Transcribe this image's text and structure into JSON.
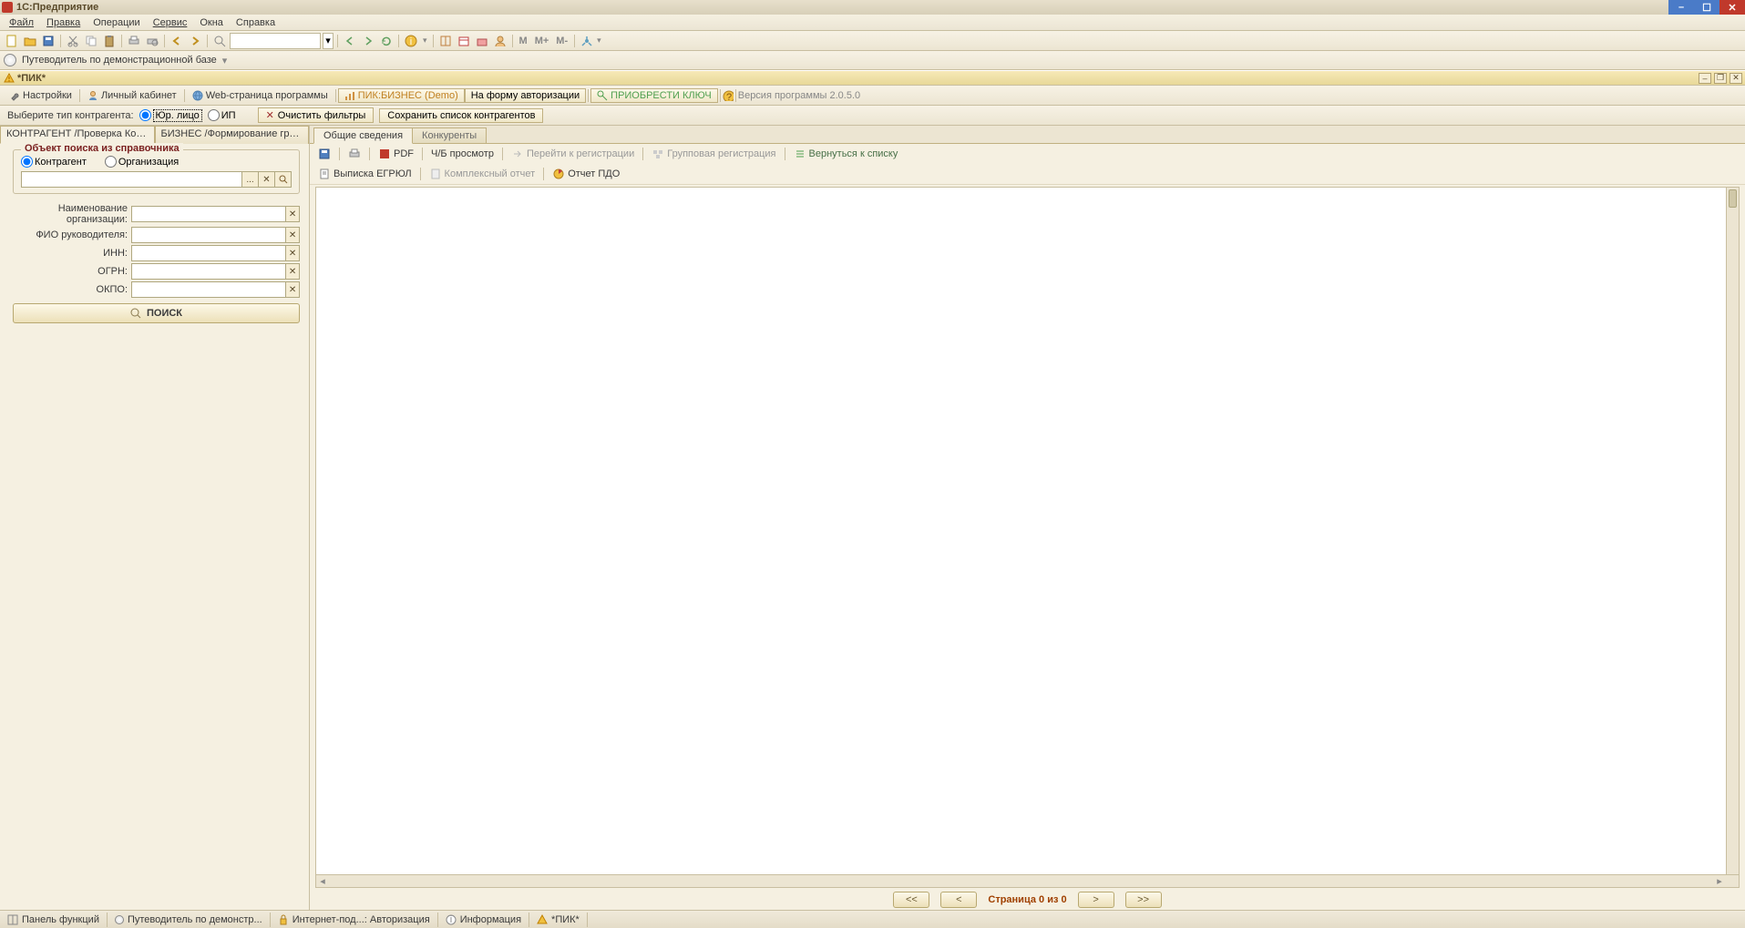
{
  "app": {
    "title": "1С:Предприятие"
  },
  "menu": [
    "Файл",
    "Правка",
    "Операции",
    "Сервис",
    "Окна",
    "Справка"
  ],
  "toolbar2": {
    "guide": "Путеводитель по демонстрационной базе"
  },
  "windowTitle": "*ПИК*",
  "tabsRow": {
    "settings": "Настройки",
    "personal": "Личный кабинет",
    "webpage": "Web-страница программы",
    "pikBusiness": "ПИК:БИЗНЕС (Demo)",
    "authForm": "На форму авторизации",
    "buyKey": "ПРИОБРЕСТИ КЛЮЧ",
    "version": "Версия программы 2.0.5.0"
  },
  "filter": {
    "label": "Выберите тип контрагента:",
    "legal": "Юр. лицо",
    "ip": "ИП",
    "clear": "Очистить фильтры",
    "save": "Сохранить список контрагентов"
  },
  "panelTabs": {
    "contr": "КОНТРАГЕНТ /Проверка Контраг ...",
    "business": "БИЗНЕС /Формирование группы ..."
  },
  "fieldset": {
    "legend": "Объект поиска из справочника",
    "contragent": "Контрагент",
    "org": "Организация"
  },
  "form": {
    "orgName": "Наименование организации:",
    "fio": "ФИО руководителя:",
    "inn": "ИНН:",
    "ogrn": "ОГРН:",
    "okpo": "ОКПО:",
    "search": "ПОИСК"
  },
  "contentTabs": {
    "general": "Общие сведения",
    "competitors": "Конкуренты"
  },
  "contentToolbar": {
    "pdf": "PDF",
    "bw": "Ч/Б  просмотр",
    "gotoReg": "Перейти к регистрации",
    "groupReg": "Групповая регистрация",
    "back": "Вернуться к списку",
    "egrul": "Выписка ЕГРЮЛ",
    "complexReport": "Комплексный отчет",
    "pdoReport": "Отчет ПДО"
  },
  "pager": {
    "first": "<<",
    "prev": "<",
    "text": "Страница  0 из  0",
    "next": ">",
    "last": ">>"
  },
  "statusBar": {
    "panel": "Панель функций",
    "guide": "Путеводитель по демонстр...",
    "internet": "Интернет-под...: Авторизация",
    "info": "Информация",
    "pik": "*ПИК*"
  }
}
